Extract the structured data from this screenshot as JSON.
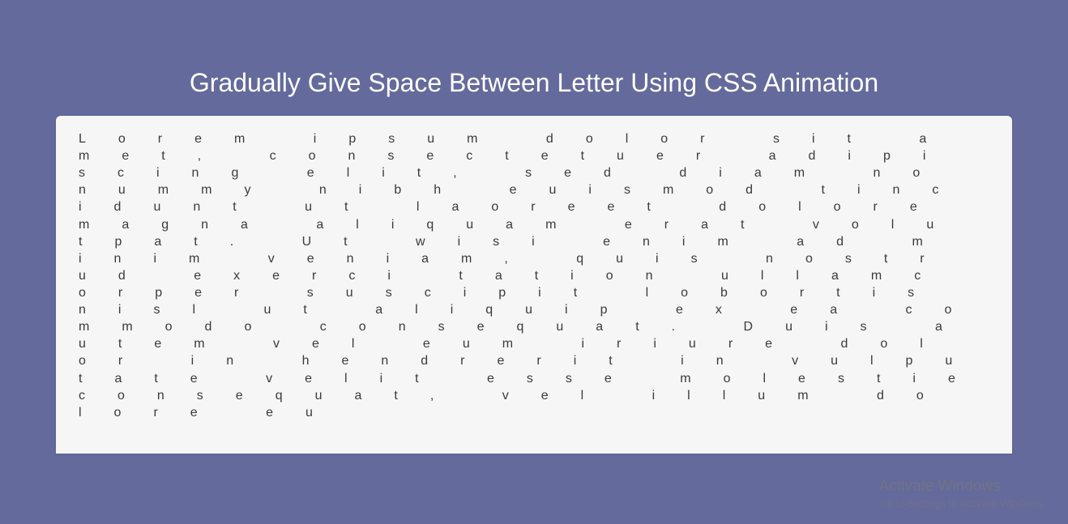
{
  "header": {
    "title": "Gradually Give Space Between Letter Using CSS Animation"
  },
  "content": {
    "paragraph": "Lorem ipsum dolor sit amet, consectetuer adipiscing elit, sed diam nonummy nibh euismod tincidunt ut laoreet dolore magna aliquam erat volutpat. Ut wisi enim ad minim veniam, quis nostrud exerci tation ullamcorper suscipit lobortis nisl ut aliquip ex ea commodo consequat. Duis autem vel eum iriure dolor in hendrerit in vulputate velit esse molestie consequat, vel illum dolore eu"
  },
  "watermark": {
    "line1": "Activate Windows",
    "line2": "Go to Settings to activate Windows."
  }
}
